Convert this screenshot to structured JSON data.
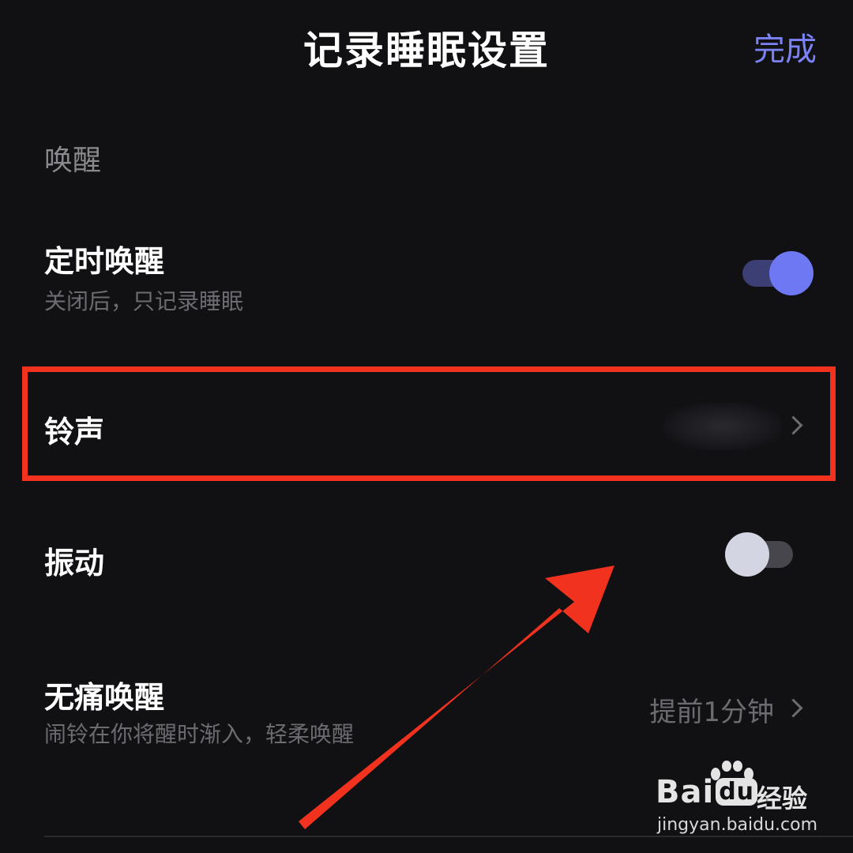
{
  "header": {
    "title": "记录睡眠设置",
    "done_label": "完成"
  },
  "wake_section": {
    "label": "唤醒",
    "scheduled_wake": {
      "title": "定时唤醒",
      "subtitle": "关闭后，只记录睡眠",
      "enabled": true
    },
    "ringtone": {
      "title": "铃声",
      "value_obscured": true
    },
    "vibration": {
      "title": "振动",
      "enabled": false
    },
    "gentle_wake": {
      "title": "无痛唤醒",
      "subtitle": "闹铃在你将醒时渐入，轻柔唤醒",
      "value": "提前1分钟"
    }
  },
  "watermark": {
    "brand_left": "Bai",
    "brand_du": "du",
    "brand_name": "经验",
    "url": "jingyan.baidu.com"
  },
  "colors": {
    "background": "#111013",
    "accent": "#7b82f3",
    "toggle_on_knob": "#6e78f3",
    "toggle_on_track": "#3b3f73",
    "annotation_red": "#f0321e"
  }
}
